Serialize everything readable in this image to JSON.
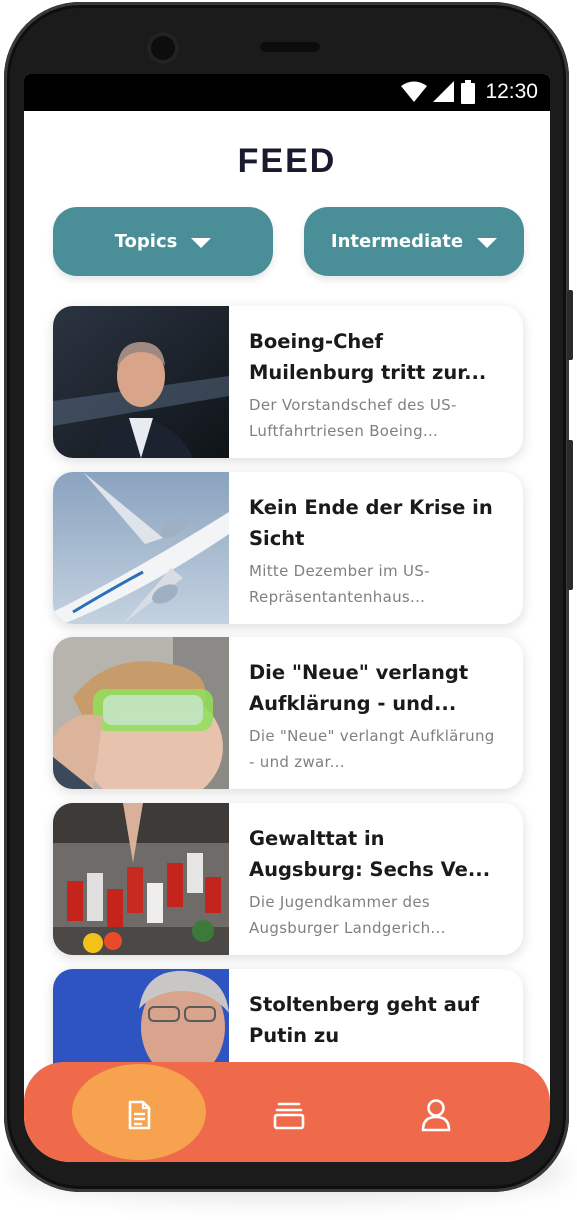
{
  "status_bar": {
    "time": "12:30",
    "icons": [
      "wifi-icon",
      "signal-icon",
      "battery-icon"
    ]
  },
  "header": {
    "title": "FEED"
  },
  "filters": {
    "topics_label": "Topics",
    "level_label": "Intermediate"
  },
  "articles": [
    {
      "title": "Boeing-Chef Muilenburg tritt zur...",
      "description": "Der Vorstandschef des US-Luftfahrtriesen Boeing..."
    },
    {
      "title": "Kein Ende der Krise in Sicht",
      "description": "Mitte Dezember im US-Repräsentantenhaus..."
    },
    {
      "title": "Die \"Neue\" verlangt Aufklärung - und...",
      "description": "Die \"Neue\" verlangt Aufklärung - und zwar..."
    },
    {
      "title": "Gewalttat in Augsburg: Sechs Ve...",
      "description": "Die Jugendkammer des Augsburger Landgerich..."
    },
    {
      "title": "Stoltenberg geht auf Putin zu",
      "description": ""
    }
  ],
  "bottom_nav": {
    "items": [
      "feed-icon",
      "cards-icon",
      "profile-icon"
    ],
    "active": "feed-icon"
  },
  "colors": {
    "accent_teal": "#4a8f97",
    "nav_background": "#ef6a4b",
    "nav_active": "#f6a24f",
    "title_text": "#1a1a2e"
  }
}
